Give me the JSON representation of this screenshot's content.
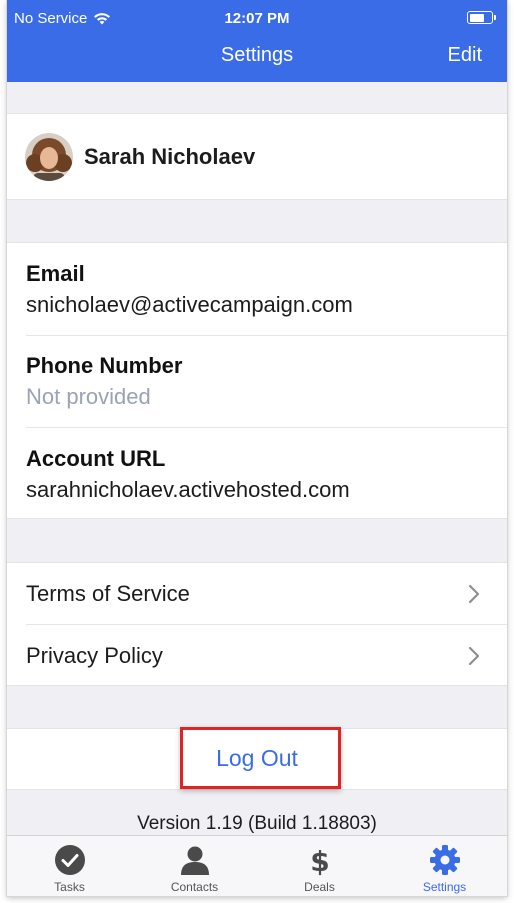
{
  "status_bar": {
    "carrier": "No Service",
    "time": "12:07 PM",
    "battery_level": 0.7
  },
  "nav": {
    "title": "Settings",
    "edit_label": "Edit"
  },
  "profile": {
    "name": "Sarah Nicholaev"
  },
  "info": [
    {
      "label": "Email",
      "value": "snicholaev@activecampaign.com"
    },
    {
      "label": "Phone Number",
      "value": "Not provided"
    },
    {
      "label": "Account URL",
      "value": "sarahnicholaev.activehosted.com"
    }
  ],
  "links": [
    {
      "label": "Terms of Service"
    },
    {
      "label": "Privacy Policy"
    }
  ],
  "logout": {
    "label": "Log Out"
  },
  "version": "Version 1.19 (Build 1.18803)",
  "tabs": [
    {
      "label": "Tasks",
      "icon": "check-circle-icon"
    },
    {
      "label": "Contacts",
      "icon": "person-icon"
    },
    {
      "label": "Deals",
      "icon": "dollar-icon"
    },
    {
      "label": "Settings",
      "icon": "gear-icon",
      "active": true
    }
  ],
  "colors": {
    "accent": "#3a6ce8",
    "highlight": "#e02424",
    "muted": "#9aa3b5",
    "grouped_bg": "#efeff4"
  }
}
